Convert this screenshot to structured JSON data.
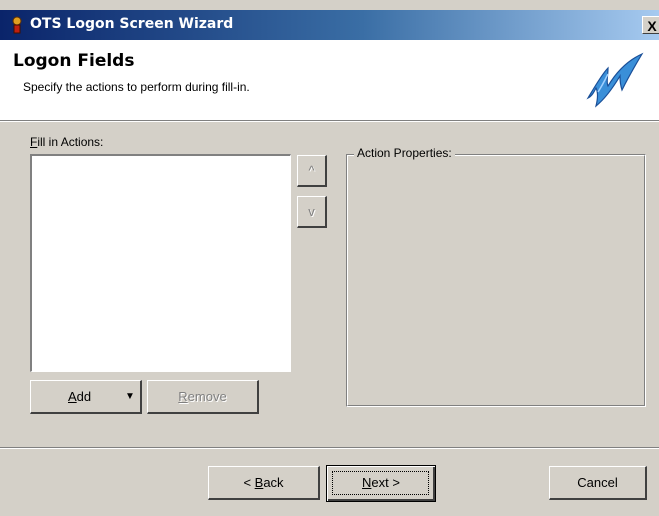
{
  "window": {
    "title": "OTS Logon Screen Wizard",
    "close_label": "X"
  },
  "header": {
    "title": "Logon Fields",
    "subtitle": "Specify the actions to perform during fill-in."
  },
  "fill_in_actions": {
    "label_accel": "F",
    "label_rest": "ill in Actions:",
    "items": []
  },
  "move_buttons": {
    "up_label": "^",
    "down_label": "v"
  },
  "add_button": {
    "label_accel": "A",
    "label_rest": "dd",
    "dropdown_glyph": "▼"
  },
  "remove_button": {
    "label_accel": "R",
    "label_rest": "emove"
  },
  "action_properties": {
    "legend": "Action Properties:"
  },
  "navigation": {
    "back_prefix": "< ",
    "back_accel": "B",
    "back_rest": "ack",
    "next_accel": "N",
    "next_rest": "ext >",
    "cancel_label": "Cancel"
  },
  "icons": {
    "title_icon": "wizard-app-icon",
    "logo": "lightning-logo-icon"
  },
  "colors": {
    "title_bar_start": "#0a246a",
    "title_bar_end": "#a6caf0",
    "logo_blue": "#3a8fd8",
    "dialog_face": "#d4d0c8"
  }
}
